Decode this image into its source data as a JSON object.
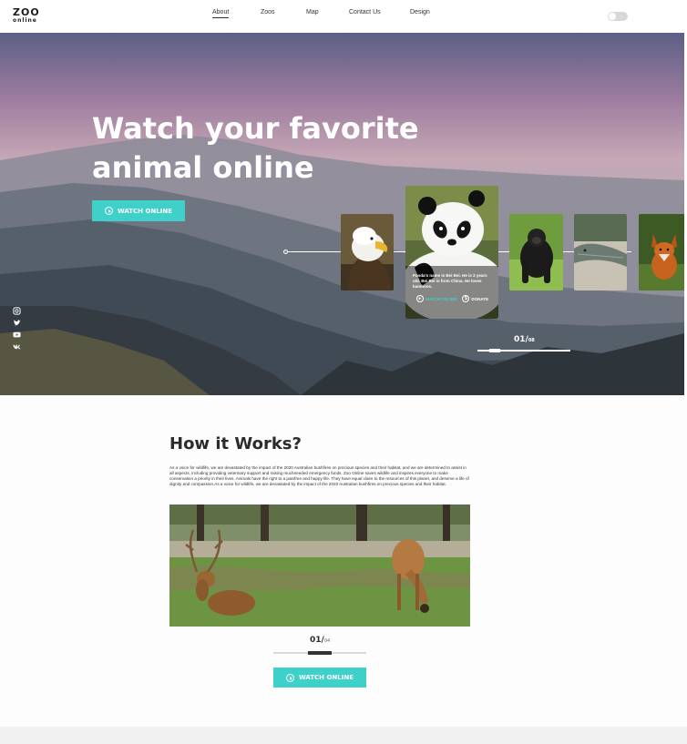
{
  "header": {
    "logo_top": "ZOO",
    "logo_bottom": "online",
    "nav": [
      {
        "label": "About",
        "active": true
      },
      {
        "label": "Zoos"
      },
      {
        "label": "Map"
      },
      {
        "label": "Contact Us"
      },
      {
        "label": "Design"
      }
    ],
    "theme_toggle_on": false
  },
  "hero": {
    "title": "Watch your favorite animal online",
    "cta_label": "WATCH ONLINE",
    "social_icons": [
      "instagram-icon",
      "twitter-icon",
      "youtube-icon",
      "vk-icon"
    ],
    "cards": [
      "eagle",
      "panda",
      "gorilla",
      "crocodile",
      "fox"
    ],
    "featured_card": {
      "animal": "panda",
      "description": "Panda's name is Bei Bei. He is 2 years old. Bei Bei is from China. He loves bamboos.",
      "watch_label": "WATCH ONLINE",
      "donate_label": "DONATE"
    },
    "slider": {
      "current": "01/",
      "total": "08",
      "position": 0.125
    }
  },
  "how": {
    "title": "How it Works?",
    "text": "As a voice for wildlife, we are devastated by the impact of the 2020 Australian bushfires on precious species and their habitat, and we are determined to assist in all aspects, including providing veterinary support and raising muchneeded emergency funds. Zoo Online saves wildlife and inspires everyone to make conservation a priority in their lives. Animals have the right to a painfree and happy life. They have equal claim to the resources of this planet, and deserve a life of dignity and compassion.As a voice for wildlife, we are devastated by the impact of the 2020 Australian bushfires on precious species and their habitat.",
    "photo": "deer",
    "slider": {
      "current": "01/",
      "total": "04",
      "position": 0.375
    },
    "cta_label": "WATCH ONLINE"
  },
  "colors": {
    "accent": "#3fd0c9",
    "text": "#2b2b2b"
  }
}
